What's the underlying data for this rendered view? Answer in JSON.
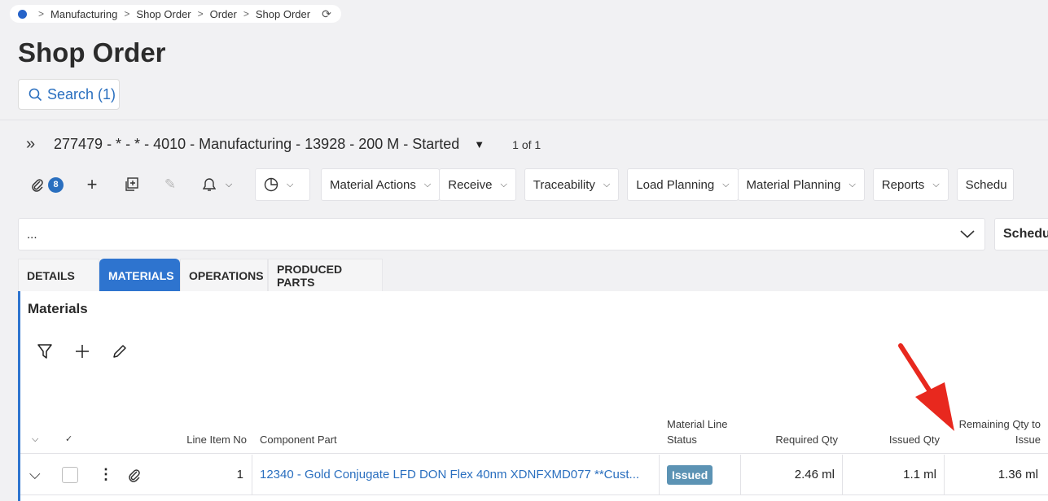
{
  "breadcrumb": {
    "items": [
      "Manufacturing",
      "Shop Order",
      "Order",
      "Shop Order"
    ],
    "sep": ">",
    "refresh_icon": "refresh-icon"
  },
  "page": {
    "title": "Shop Order"
  },
  "search": {
    "label": "Search (1)"
  },
  "record": {
    "title": "277479 - * - * - 4010 - Manufacturing - 13928 - 200 M - Started",
    "count": "1 of 1"
  },
  "toolbar": {
    "attachments_count": "8",
    "buttons": [
      "Material Actions",
      "Receive",
      "Traceability",
      "Load Planning",
      "Material Planning",
      "Reports",
      "Schedu"
    ]
  },
  "ellipsis_bar": {
    "text": "...",
    "right_label": "Schedu"
  },
  "tabs": [
    "DETAILS",
    "MATERIALS",
    "OPERATIONS",
    "PRODUCED PARTS"
  ],
  "materials": {
    "title": "Materials",
    "columns": {
      "line_item_no": "Line Item No",
      "component_part": "Component Part",
      "material_line_status": "Material Line Status",
      "required_qty": "Required Qty",
      "issued_qty": "Issued Qty",
      "remaining_qty": "Remaining Qty to Issue"
    },
    "rows": [
      {
        "line_item_no": "1",
        "component_part": "12340 - Gold Conjugate LFD DON Flex 40nm XDNFXMD077 **Cust...",
        "status": "Issued",
        "required_qty": "2.46 ml",
        "issued_qty": "1.1 ml",
        "remaining_qty": "1.36 ml"
      }
    ]
  },
  "colors": {
    "accent": "#2e74cf",
    "status_issued": "#5c93b4",
    "annotation_arrow": "#e8281e"
  }
}
